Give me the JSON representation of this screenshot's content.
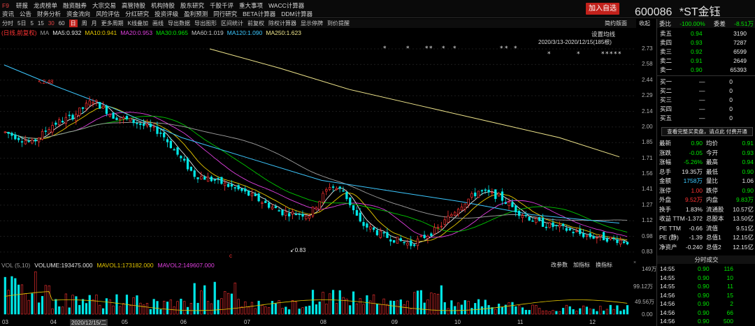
{
  "nav": {
    "row1": [
      "研报",
      "龙虎榜单",
      "融资融券",
      "大宗交易",
      "高管持股",
      "机构持股",
      "股东研究",
      "千股千评",
      "重大事项",
      "WACC计算器"
    ],
    "f9": "F9",
    "row2": [
      "资讯",
      "公告",
      "财务分析",
      "资金流向",
      "风险评估",
      "分红研究",
      "投资评级",
      "盈利预测",
      "同行研究",
      "BETA计算器",
      "DDM计算器"
    ],
    "add_button": "加入自选",
    "stock_code": "600086",
    "stock_name": "*ST金钰"
  },
  "toolbar": {
    "items": [
      "分时",
      "5日",
      "5",
      "15",
      "30",
      "60",
      "日",
      "周",
      "月",
      "更多周期",
      "K线叠加",
      "画线",
      "导出数据",
      "导出图形",
      "区间统计",
      "前复权",
      "除权计算器",
      "显示停牌",
      "到价提醒"
    ],
    "active": "日",
    "minimize": "简约版面",
    "collapse": "收起"
  },
  "ma": {
    "label": "(日线,前复权)",
    "ma": "MA",
    "ma5": "MA5:0.932",
    "ma10": "MA10:0.941",
    "ma20": "MA20:0.953",
    "ma30": "MA30:0.965",
    "ma60": "MA60:1.019",
    "ma120": "MA120:1.090",
    "ma250": "MA250:1.623",
    "set_ma": "设置均线",
    "range": "2020/3/13-2020/12/15(185根)"
  },
  "price_axis": [
    "2.73",
    "2.58",
    "2.44",
    "2.29",
    "2.14",
    "2.00",
    "1.85",
    "1.71",
    "1.56",
    "1.41",
    "1.27",
    "1.12",
    "0.98",
    "0.83"
  ],
  "annotations": {
    "high": "2.48",
    "low": "0.83",
    "marker": "c"
  },
  "volume": {
    "label": "VOL (5,10)",
    "volume": "VOLUME:193475.000",
    "mavol1": "MAVOL1:173182.000",
    "mavol2": "MAVOL2:149607.000",
    "btn1": "改参数",
    "btn2": "加指标",
    "btn3": "换指标",
    "axis": [
      "149万",
      "99.12万",
      "49.56万",
      "0.00"
    ]
  },
  "months": [
    "03",
    "04",
    "2020/12/15/二",
    "05",
    "06",
    "07",
    "08",
    "09",
    "10",
    "11",
    "12"
  ],
  "panel": {
    "weibi_label": "委比",
    "weibi": "-100.00%",
    "weicha_label": "委差",
    "weicha": "-8.51万",
    "sells": [
      {
        "label": "卖五",
        "price": "0.94",
        "vol": "3190"
      },
      {
        "label": "卖四",
        "price": "0.93",
        "vol": "7287"
      },
      {
        "label": "卖三",
        "price": "0.92",
        "vol": "6599"
      },
      {
        "label": "卖二",
        "price": "0.91",
        "vol": "2649"
      },
      {
        "label": "卖一",
        "price": "0.90",
        "vol": "65393"
      }
    ],
    "buys": [
      {
        "label": "买一",
        "price": "—",
        "vol": "0"
      },
      {
        "label": "买二",
        "price": "—",
        "vol": "0"
      },
      {
        "label": "买三",
        "price": "—",
        "vol": "0"
      },
      {
        "label": "买四",
        "price": "—",
        "vol": "0"
      },
      {
        "label": "买五",
        "price": "—",
        "vol": "0"
      }
    ],
    "notice": "查看完整买卖盘，请点此 付费开通",
    "stats": [
      {
        "l1": "最新",
        "v1": "0.90",
        "c1": "green",
        "l2": "均价",
        "v2": "0.91",
        "c2": "green"
      },
      {
        "l1": "涨跌",
        "v1": "-0.05",
        "c1": "green",
        "l2": "今开",
        "v2": "0.93",
        "c2": "green"
      },
      {
        "l1": "涨幅",
        "v1": "-5.26%",
        "c1": "green",
        "l2": "最高",
        "v2": "0.94",
        "c2": "green"
      },
      {
        "l1": "总手",
        "v1": "19.35万",
        "c1": "white",
        "l2": "最低",
        "v2": "0.90",
        "c2": "green"
      },
      {
        "l1": "金额",
        "v1": "1758万",
        "c1": "cyan",
        "l2": "量比",
        "v2": "1.06",
        "c2": "white"
      },
      {
        "l1": "涨停",
        "v1": "1.00",
        "c1": "red",
        "l2": "跌停",
        "v2": "0.90",
        "c2": "green"
      },
      {
        "l1": "外盘",
        "v1": "9.52万",
        "c1": "red",
        "l2": "内盘",
        "v2": "9.83万",
        "c2": "green"
      },
      {
        "l1": "换手",
        "v1": "1.83%",
        "c1": "white",
        "l2": "流通股",
        "v2": "10.57亿",
        "c2": "white"
      },
      {
        "l1": "收益 TTM",
        "v1": "-1.372",
        "c1": "white",
        "l2": "总股本",
        "v2": "13.50亿",
        "c2": "white"
      },
      {
        "l1": "PE TTM",
        "v1": "-0.66",
        "c1": "white",
        "l2": "流值",
        "v2": "9.51亿",
        "c2": "white"
      },
      {
        "l1": "PE (静)",
        "v1": "-1.39",
        "c1": "white",
        "l2": "总值1",
        "v2": "12.15亿",
        "c2": "white"
      },
      {
        "l1": "净资产",
        "v1": "-0.240",
        "c1": "white",
        "l2": "总值2",
        "v2": "12.15亿",
        "c2": "white"
      }
    ],
    "trade_header": "分时成交",
    "trades": [
      {
        "t": "14:55",
        "p": "0.90",
        "v": "116"
      },
      {
        "t": "14:55",
        "p": "0.90",
        "v": "10"
      },
      {
        "t": "14:55",
        "p": "0.90",
        "v": "11"
      },
      {
        "t": "14:56",
        "p": "0.90",
        "v": "15"
      },
      {
        "t": "14:56",
        "p": "0.90",
        "v": "2"
      },
      {
        "t": "14:56",
        "p": "0.90",
        "v": "66"
      },
      {
        "t": "14:56",
        "p": "0.90",
        "v": "500"
      }
    ]
  }
}
